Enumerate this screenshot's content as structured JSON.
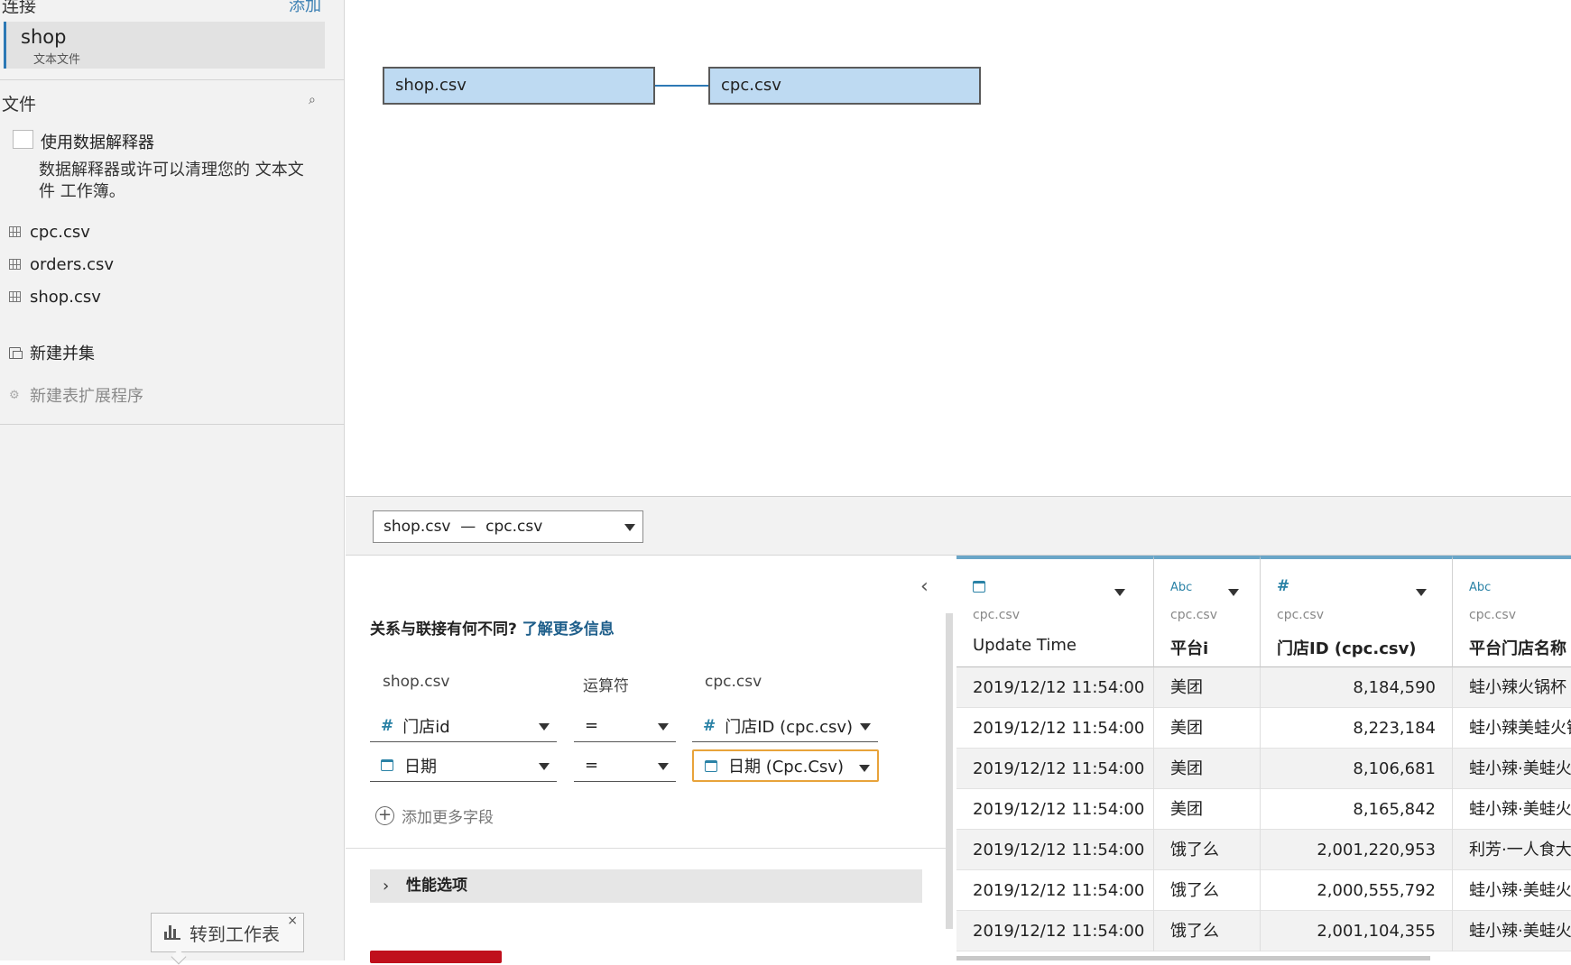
{
  "sidebar": {
    "connections_title": "连接",
    "add_label": "添加",
    "connection": {
      "name": "shop",
      "type": "文本文件"
    },
    "files_title": "文件",
    "interpreter_label": "使用数据解释器",
    "interpreter_desc": "数据解释器或许可以清理您的 文本文件 工作簿。",
    "files": [
      "cpc.csv",
      "orders.csv",
      "shop.csv"
    ],
    "new_union": "新建并集",
    "new_extension": "新建表扩展程序"
  },
  "canvas": {
    "left_table": "shop.csv",
    "right_table": "cpc.csv"
  },
  "relationship": {
    "selector": "shop.csv  —  cpc.csv",
    "question": "关系与联接有何不同?",
    "learn_more": "了解更多信息",
    "col_left": "shop.csv",
    "col_op": "运算符",
    "col_right": "cpc.csv",
    "clauses": [
      {
        "left": "门店id",
        "op": "=",
        "right": "门店ID (cpc.csv)",
        "type": "number"
      },
      {
        "left": "日期",
        "op": "=",
        "right": "日期 (Cpc.Csv)",
        "type": "date"
      }
    ],
    "add_field": "添加更多字段",
    "performance": "性能选项"
  },
  "worksheet_tab": {
    "label": "转到工作表",
    "close": "×"
  },
  "grid": {
    "columns": [
      {
        "type": "date",
        "type_label": "",
        "source": "cpc.csv",
        "name": "Update Time"
      },
      {
        "type": "string",
        "type_label": "Abc",
        "source": "cpc.csv",
        "name": "平台i"
      },
      {
        "type": "number",
        "type_label": "#",
        "source": "cpc.csv",
        "name": "门店ID (cpc.csv)"
      },
      {
        "type": "string",
        "type_label": "Abc",
        "source": "cpc.csv",
        "name": "平台门店名称"
      }
    ],
    "rows": [
      [
        "2019/12/12 11:54:00",
        "美团",
        "8,184,590",
        "蛙小辣火锅杯"
      ],
      [
        "2019/12/12 11:54:00",
        "美团",
        "8,223,184",
        "蛙小辣美蛙火锅"
      ],
      [
        "2019/12/12 11:54:00",
        "美团",
        "8,106,681",
        "蛙小辣·美蛙火"
      ],
      [
        "2019/12/12 11:54:00",
        "美团",
        "8,165,842",
        "蛙小辣·美蛙火"
      ],
      [
        "2019/12/12 11:54:00",
        "饿了么",
        "2,001,220,953",
        "利芳·一人食大"
      ],
      [
        "2019/12/12 11:54:00",
        "饿了么",
        "2,000,555,792",
        "蛙小辣·美蛙火"
      ],
      [
        "2019/12/12 11:54:00",
        "饿了么",
        "2,001,104,355",
        "蛙小辣·美蛙火"
      ]
    ]
  }
}
